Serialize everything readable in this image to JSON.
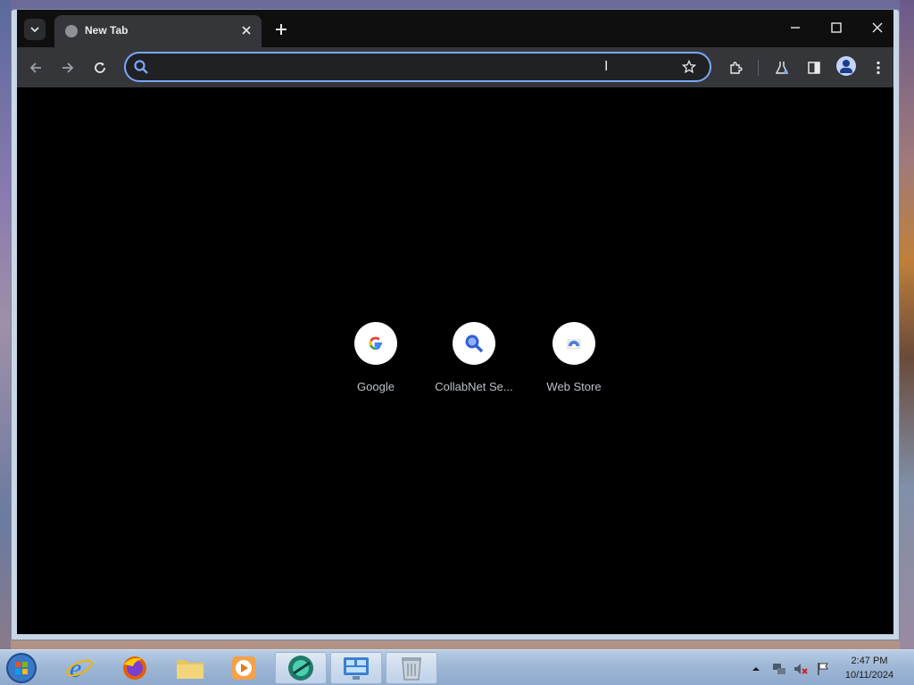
{
  "browser": {
    "tab": {
      "title": "New Tab"
    },
    "omnibox": {
      "value": "",
      "placeholder": ""
    }
  },
  "shortcuts": [
    {
      "label": "Google",
      "icon": "google-icon"
    },
    {
      "label": "CollabNet Se...",
      "icon": "search-icon"
    },
    {
      "label": "Web Store",
      "icon": "web-store-icon"
    }
  ],
  "taskbar": {
    "apps": [
      {
        "name": "internet-explorer",
        "icon": "ie-icon"
      },
      {
        "name": "firefox",
        "icon": "firefox-icon"
      },
      {
        "name": "file-explorer",
        "icon": "folder-icon"
      },
      {
        "name": "media-player",
        "icon": "play-icon"
      },
      {
        "name": "chrome-app",
        "icon": "browser-icon"
      },
      {
        "name": "control-panel",
        "icon": "control-panel-icon"
      },
      {
        "name": "recycle-bin",
        "icon": "recycle-bin-icon"
      }
    ],
    "clock": {
      "time": "2:47 PM",
      "date": "10/11/2024"
    }
  }
}
